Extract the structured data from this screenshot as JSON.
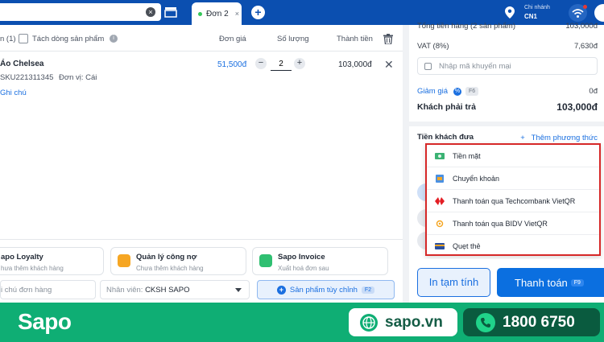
{
  "topbar": {
    "tab_label": "Đơn 2",
    "tab_close": "×",
    "clear_glyph": "×",
    "add_glyph": "+",
    "branch_title": "Chi nhánh",
    "branch_name": "CN1",
    "accent_color": "#0b4fb0"
  },
  "table": {
    "header_count": "n (1)",
    "merge_label": "Tách dòng sản phẩm",
    "col_price": "Đơn giá",
    "col_qty": "Số lượng",
    "col_total": "Thành tiền"
  },
  "product": {
    "name": "Áo Chelsea",
    "price": "51,500đ",
    "qty": "2",
    "minus": "−",
    "plus": "+",
    "total": "103,000đ",
    "remove": "✕",
    "sku": "SKU221311345",
    "unit": "Đơn vị: Cái",
    "note": "Ghi chú"
  },
  "cards": [
    {
      "title": "apo Loyalty",
      "sub": "hưa thêm khách hàng"
    },
    {
      "title": "Quản lý công nợ",
      "sub": "Chưa thêm khách hàng"
    },
    {
      "title": "Sapo Invoice",
      "sub": "Xuất hoá đơn sau"
    }
  ],
  "footer_inputs": {
    "note_placeholder": "i chú đơn hàng",
    "staff_label": "Nhân viên: ",
    "staff_value": "CKSH SAPO",
    "custom_product": "Sản phẩm tùy chỉnh",
    "custom_key": "F2"
  },
  "summary": {
    "subtotal_label": "Tổng tiền hàng (2 sản phẩm)",
    "subtotal_value": "103,000đ",
    "vat_label": "VAT (8%)",
    "vat_value": "7,630đ",
    "promo_placeholder": "Nhập mã khuyến mại",
    "discount_label": "Giảm giá",
    "discount_icon": "%",
    "discount_key": "F6",
    "discount_value": "0đ",
    "payable_label": "Khách phải trả",
    "payable_value": "103,000đ",
    "paid_label": "Tiền khách đưa",
    "add_method": "Thêm phương thức",
    "add_method_icon": "+"
  },
  "payment_methods": [
    {
      "label": "Tiền mặt",
      "icon": "cash-icon"
    },
    {
      "label": "Chuyển khoản",
      "icon": "transfer-icon"
    },
    {
      "label": "Thanh toán qua Techcombank VietQR",
      "icon": "techcombank-icon"
    },
    {
      "label": "Thanh toán qua BIDV VietQR",
      "icon": "bidv-icon"
    },
    {
      "label": "Quẹt thẻ",
      "icon": "card-icon"
    }
  ],
  "actions": {
    "hold_label": "In tạm tính",
    "pay_label": "Thanh toán",
    "pay_key": "F9"
  },
  "banner": {
    "logo": "Sapo",
    "website": "sapo.vn",
    "hotline": "1800 6750",
    "bg_color": "#0fae74"
  }
}
